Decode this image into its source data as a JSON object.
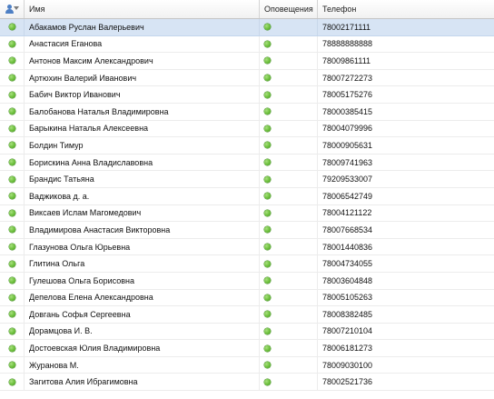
{
  "header": {
    "name_label": "Имя",
    "notifications_label": "Оповещения",
    "phone_label": "Телефон",
    "icon": "user-dropdown-icon"
  },
  "colors": {
    "selected_row": "#d7e4f4",
    "status_dot": "#6bbf3a",
    "header_icon": "#4d7fc4"
  },
  "rows": [
    {
      "name": "Абакамов Руслан Валерьевич",
      "phone": "78002171111",
      "status": "green",
      "selected": true
    },
    {
      "name": "Анастасия Еганова",
      "phone": "78888888888",
      "status": "green"
    },
    {
      "name": "Антонов Максим Александрович",
      "phone": "78009861111",
      "status": "green"
    },
    {
      "name": "Артюхин Валерий Иванович",
      "phone": "78007272273",
      "status": "green"
    },
    {
      "name": "Бабич Виктор Иванович",
      "phone": "78005175276",
      "status": "green"
    },
    {
      "name": "Балобанова Наталья Владимировна",
      "phone": "78000385415",
      "status": "green"
    },
    {
      "name": "Барыкина Наталья Алексеевна",
      "phone": "78004079996",
      "status": "green"
    },
    {
      "name": "Болдин Тимур",
      "phone": "78000905631",
      "status": "green"
    },
    {
      "name": "Борискина Анна Владиславовна",
      "phone": "78009741963",
      "status": "green"
    },
    {
      "name": "Брандис Татьяна",
      "phone": "79209533007",
      "status": "green"
    },
    {
      "name": "Ваджикова д. а.",
      "phone": "78006542749",
      "status": "green"
    },
    {
      "name": "Виксаев Ислам Магомедович",
      "phone": "78004121122",
      "status": "green"
    },
    {
      "name": "Владимирова Анастасия Викторовна",
      "phone": "78007668534",
      "status": "green"
    },
    {
      "name": "Глазунова Ольга Юрьевна",
      "phone": "78001440836",
      "status": "green"
    },
    {
      "name": "Глитина Ольга",
      "phone": "78004734055",
      "status": "green"
    },
    {
      "name": "Гулешова Ольга Борисовна",
      "phone": "78003604848",
      "status": "green"
    },
    {
      "name": "Депелова Елена Александровна",
      "phone": "78005105263",
      "status": "green"
    },
    {
      "name": "Довгань Софья Сергеевна",
      "phone": "78008382485",
      "status": "green"
    },
    {
      "name": "Дорамцова И. В.",
      "phone": "78007210104",
      "status": "green"
    },
    {
      "name": "Достоевская Юлия Владимировна",
      "phone": "78006181273",
      "status": "green"
    },
    {
      "name": "Журанова М.",
      "phone": "78009030100",
      "status": "green"
    },
    {
      "name": "Загитова Алия Ибрагимовна",
      "phone": "78002521736",
      "status": "green"
    }
  ]
}
